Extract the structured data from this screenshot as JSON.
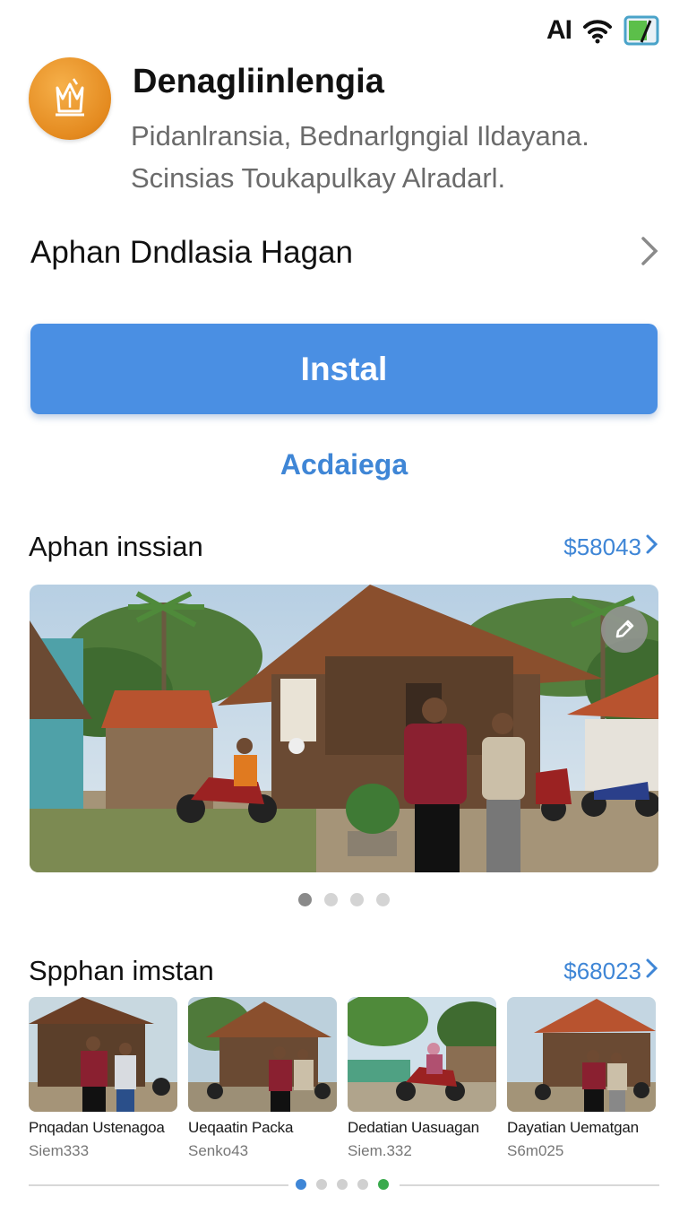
{
  "status_bar": {
    "carrier_text": "AI"
  },
  "app": {
    "name": "Denagliinlengia",
    "description": "Pidanlransia, Bednarlgngial Ildayana. Scinsias Toukapulkay Alradarl.",
    "icon": "temple-gate-icon",
    "icon_color": "#e8921f"
  },
  "link_row": {
    "label": "Aphan Dndlasia Hagan"
  },
  "install_button": {
    "label": "Instal",
    "color": "#4a8fe3"
  },
  "secondary_link": {
    "label": "Acdaiega"
  },
  "section1": {
    "title": "Aphan inssian",
    "link": "$58043"
  },
  "hero_pager": {
    "count": 4,
    "active": 0
  },
  "section2": {
    "title": "Spphan imstan",
    "link": "$68023"
  },
  "thumbnails": [
    {
      "title": "Pnqadan Ustenagoa",
      "subtitle": "Siem333"
    },
    {
      "title": "Ueqaatin Packa",
      "subtitle": "Senko43"
    },
    {
      "title": "Dedatian Uasuagan",
      "subtitle": "Siem.332"
    },
    {
      "title": "Dayatian Uematgan",
      "subtitle": "S6m025"
    }
  ],
  "bottom_pager": {
    "count": 5,
    "active": 0
  },
  "colors": {
    "accent": "#3f86d6",
    "text": "#111111",
    "muted": "#6b6b6b"
  }
}
